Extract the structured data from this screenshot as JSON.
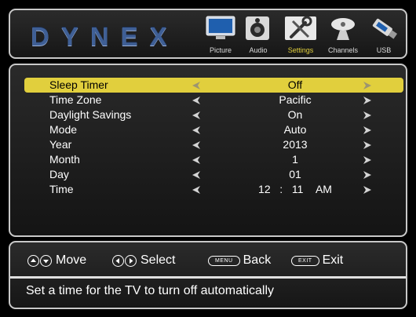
{
  "brand": "DYNEX",
  "categories": [
    {
      "label": "Picture",
      "icon": "tv-icon"
    },
    {
      "label": "Audio",
      "icon": "speaker-icon"
    },
    {
      "label": "Settings",
      "icon": "tools-icon"
    },
    {
      "label": "Channels",
      "icon": "satellite-dish-icon"
    },
    {
      "label": "USB",
      "icon": "usb-drive-icon"
    }
  ],
  "active_category": "Settings",
  "settings": [
    {
      "label": "Sleep Timer",
      "value": "Off",
      "selected": true
    },
    {
      "label": "Time Zone",
      "value": "Pacific"
    },
    {
      "label": "Daylight Savings",
      "value": "On"
    },
    {
      "label": "Mode",
      "value": "Auto"
    },
    {
      "label": "Year",
      "value": "2013"
    },
    {
      "label": "Month",
      "value": "1"
    },
    {
      "label": "Day",
      "value": "01"
    },
    {
      "label": "Time",
      "value_hour": "12",
      "value_sep": ":",
      "value_min": "11",
      "value_ampm": "AM"
    }
  ],
  "hints": {
    "move": "Move",
    "select": "Select",
    "menu_key": "MENU",
    "back": "Back",
    "exit_key": "EXIT",
    "exit": "Exit"
  },
  "description": "Set a time for the TV to turn off automatically",
  "colors": {
    "accent": "#e1cf3d",
    "brand": "#3f5f95",
    "border": "#c8c8c8"
  }
}
